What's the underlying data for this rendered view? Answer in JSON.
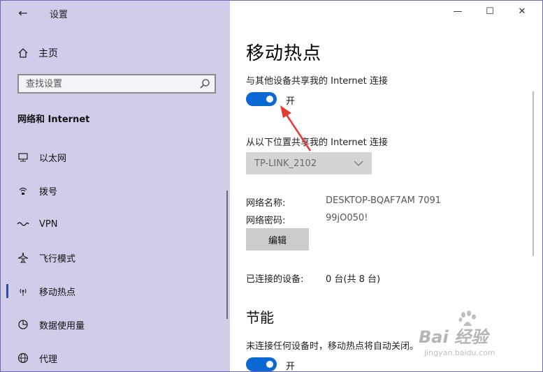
{
  "sidebar": {
    "back_glyph": "←",
    "app_title": "设置",
    "home_label": "主页",
    "search_placeholder": "查找设置",
    "section_title": "网络和 Internet",
    "items": [
      {
        "label": "以太网",
        "icon": "ethernet-icon"
      },
      {
        "label": "拨号",
        "icon": "dialup-icon"
      },
      {
        "label": "VPN",
        "icon": "vpn-icon"
      },
      {
        "label": "飞行模式",
        "icon": "airplane-icon"
      },
      {
        "label": "移动热点",
        "icon": "hotspot-icon",
        "active": true
      },
      {
        "label": "数据使用量",
        "icon": "data-usage-icon"
      },
      {
        "label": "代理",
        "icon": "globe-icon"
      }
    ]
  },
  "window": {
    "minimize": "—",
    "maximize": "☐",
    "close": "✕"
  },
  "main": {
    "title": "移动热点",
    "share_label": "与其他设备共享我的 Internet 连接",
    "share_toggle_state": "开",
    "share_from_label": "从以下位置共享我的 Internet 连接",
    "share_from_value": "TP-LINK_2102",
    "network_name_key": "网络名称:",
    "network_name_value": "DESKTOP-BQAF7AM 7091",
    "network_password_key": "网络密码:",
    "network_password_value": "99jO050!",
    "edit_button": "编辑",
    "connected_key": "已连接的设备:",
    "connected_value": "0 台(共 8 台)",
    "power_section": "节能",
    "power_desc": "未连接任何设备时，移动热点将自动关闭。",
    "power_toggle_state": "开"
  },
  "watermark": {
    "text1": "Bai 经验",
    "text2": "jingyan.baidu.com"
  },
  "colors": {
    "sidebar_bg": "#cfcdea",
    "toggle_on": "#0a67d3",
    "annotation_arrow": "#e53935"
  }
}
